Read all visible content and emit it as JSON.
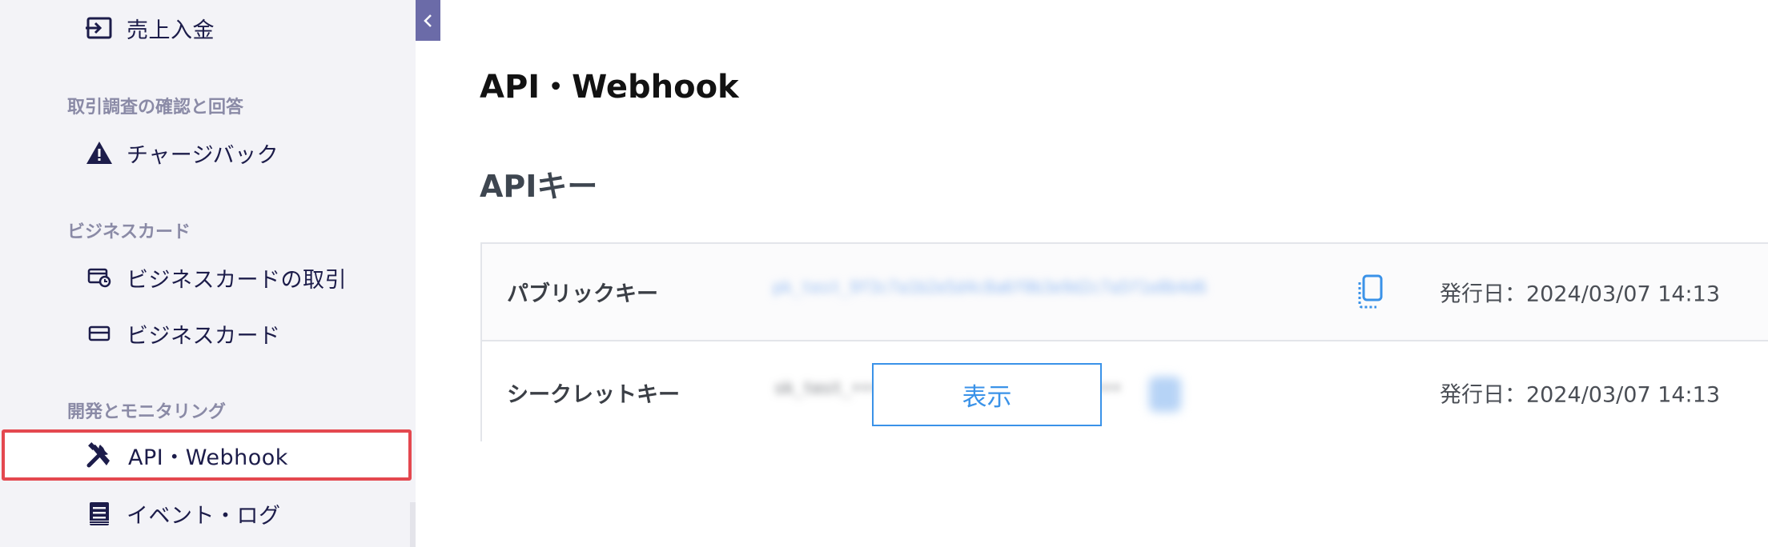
{
  "sidebar": {
    "collapse_icon": "chevron-left-icon",
    "top_item": {
      "label": "売上入金",
      "icon": "payout-icon"
    },
    "sections": [
      {
        "title": "取引調査の確認と回答",
        "items": [
          {
            "label": "チャージバック",
            "icon": "warning-icon"
          }
        ]
      },
      {
        "title": "ビジネスカード",
        "items": [
          {
            "label": "ビジネスカードの取引",
            "icon": "card-clock-icon"
          },
          {
            "label": "ビジネスカード",
            "icon": "card-icon"
          }
        ]
      },
      {
        "title": "開発とモニタリング",
        "items": [
          {
            "label": "API・Webhook",
            "icon": "tools-icon",
            "active": true
          },
          {
            "label": "イベント・ログ",
            "icon": "log-icon"
          }
        ]
      }
    ]
  },
  "main": {
    "page_title": "API・Webhook",
    "section_title": "APIキー",
    "keys": [
      {
        "label": "パブリックキー",
        "value_masked": "pk_test_9f3c7a1b2e5d4c8a6f0b3e9d2c7a5f1e8b4d6",
        "copy_icon": "copy-icon",
        "issued": "発行日：2024/03/07 14:13"
      },
      {
        "label": "シークレットキー",
        "value_masked": "sk_test_••••••••••••••••••••••••••••",
        "show_button": "表示",
        "issued": "発行日：2024/03/07 14:13"
      }
    ]
  },
  "colors": {
    "accent": "#3a92e8",
    "sidebar_bg": "#f3f3f7",
    "active_border": "#e4484f",
    "collapse_bg": "#6b6ba8"
  }
}
